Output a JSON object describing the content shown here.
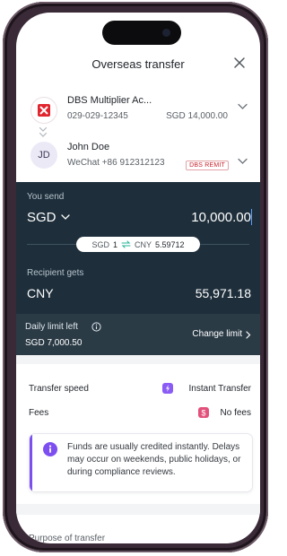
{
  "header": {
    "title": "Overseas transfer"
  },
  "source_account": {
    "name": "DBS Multiplier Ac...",
    "number": "029-029-12345",
    "balance": "SGD 14,000.00"
  },
  "recipient": {
    "initials": "JD",
    "name": "John Doe",
    "detail": "WeChat +86 912312123",
    "badge": "DBS REMIT"
  },
  "send": {
    "label": "You send",
    "currency": "SGD",
    "amount": "10,000.00"
  },
  "rate": {
    "from_currency": "SGD",
    "from_value": "1",
    "to_currency": "CNY",
    "to_value": "5.59712"
  },
  "receive": {
    "label": "Recipient gets",
    "currency": "CNY",
    "amount": "55,971.18"
  },
  "limit": {
    "label": "Daily limit left",
    "value": "SGD 7,000.50",
    "action": "Change limit"
  },
  "details": {
    "speed_label": "Transfer speed",
    "speed_value": "Instant Transfer",
    "fees_label": "Fees",
    "fees_value": "No fees"
  },
  "info_message": "Funds are usually credited instantly. Delays may occur on weekends, public holidays, or during compliance reviews.",
  "purpose": {
    "label": "Purpose of transfer"
  },
  "colors": {
    "card_dark": "#1e2f3b",
    "limit_bar": "#2b3b46",
    "accent_purple": "#7d4ff0",
    "brand_red": "#e0252e",
    "fees_pink": "#e2517a"
  },
  "icons": [
    "close-icon",
    "dbs-logo-icon",
    "chevron-down-icon",
    "swap-icon",
    "info-icon",
    "chevron-right-icon",
    "lightning-icon",
    "fee-tag-icon"
  ]
}
